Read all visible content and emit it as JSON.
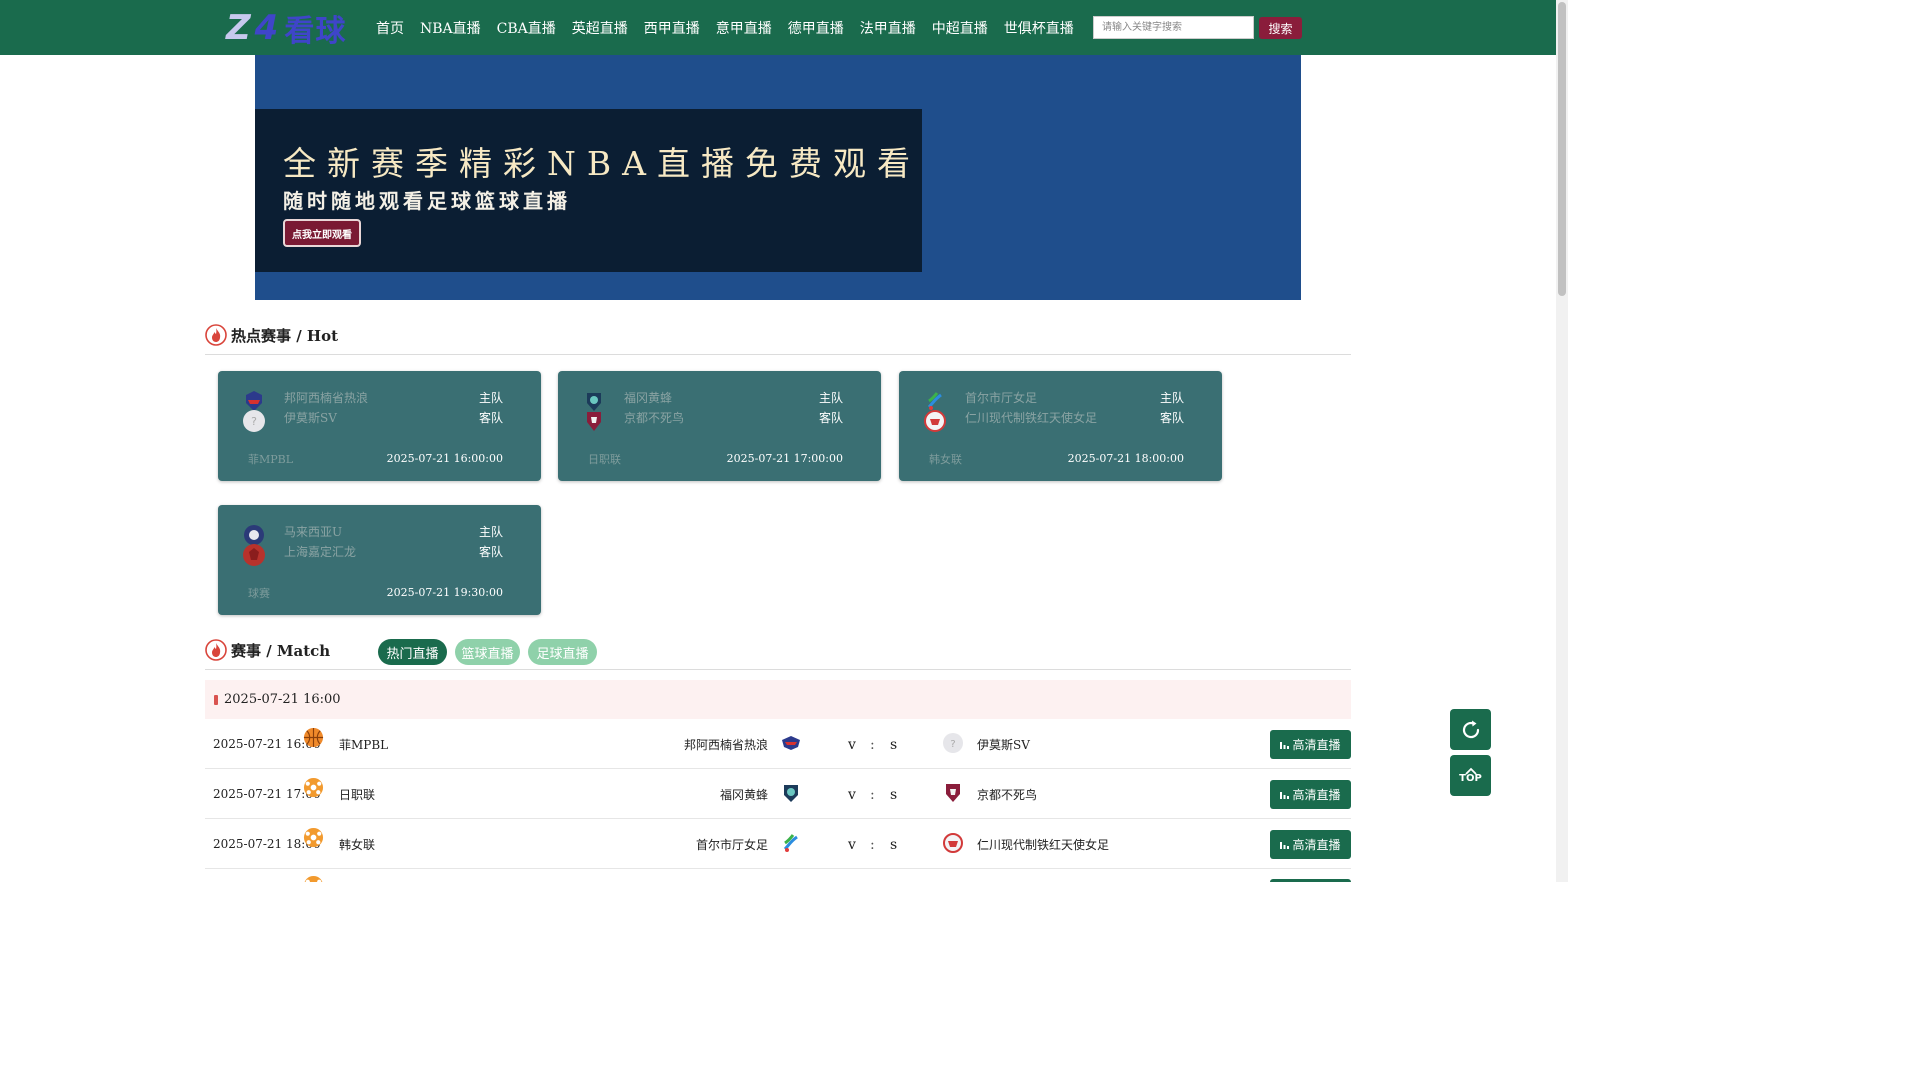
{
  "header": {
    "logo": {
      "part1": "Z",
      "part2": "4",
      "part3": "看球"
    },
    "nav": [
      "首页",
      "NBA直播",
      "CBA直播",
      "英超直播",
      "西甲直播",
      "意甲直播",
      "德甲直播",
      "法甲直播",
      "中超直播",
      "世俱杯直播"
    ],
    "search_placeholder": "请输入关键字搜索",
    "search_button": "搜索"
  },
  "banner": {
    "title": "全新赛季精彩NBA直播免费观看",
    "subtitle": "随时随地观看足球篮球直播",
    "button": "点我立即观看"
  },
  "hot": {
    "title": "热点赛事 / Hot",
    "home_label": "主队",
    "away_label": "客队",
    "cards": [
      {
        "home": "邦阿西楠省热浪",
        "away": "伊莫斯SV",
        "league": "菲MPBL",
        "time": "2025-07-21 16:00:00"
      },
      {
        "home": "福冈黄蜂",
        "away": "京都不死鸟",
        "league": "日职联",
        "time": "2025-07-21 17:00:00"
      },
      {
        "home": "首尔市厅女足",
        "away": "仁川现代制铁红天使女足",
        "league": "韩女联",
        "time": "2025-07-21 18:00:00"
      },
      {
        "home": "马来西亚U",
        "away": "上海嘉定汇龙",
        "league": "球赛",
        "time": "2025-07-21 19:30:00"
      }
    ]
  },
  "match": {
    "title": "赛事 / Match",
    "tabs": [
      "热门直播",
      "篮球直播",
      "足球直播"
    ],
    "date": "2025-07-21 16:00",
    "vs_v": "v",
    "vs_colon": ":",
    "vs_s": "s",
    "live_label": "高清直播",
    "rows": [
      {
        "time": "2025-07-21 16:00",
        "sport": "basketball",
        "league": "菲MPBL",
        "home": "邦阿西楠省热浪",
        "away": "伊莫斯SV"
      },
      {
        "time": "2025-07-21 17:00",
        "sport": "football",
        "league": "日职联",
        "home": "福冈黄蜂",
        "away": "京都不死鸟"
      },
      {
        "time": "2025-07-21 18:00",
        "sport": "football",
        "league": "韩女联",
        "home": "首尔市厅女足",
        "away": "仁川现代制铁红天使女足"
      }
    ]
  },
  "float": {
    "top_label": "TOP"
  },
  "colors": {
    "primary": "#1a6b4d",
    "accent": "#8a1d3b",
    "banner": "#1f4e8c",
    "card": "#3a6f73"
  }
}
